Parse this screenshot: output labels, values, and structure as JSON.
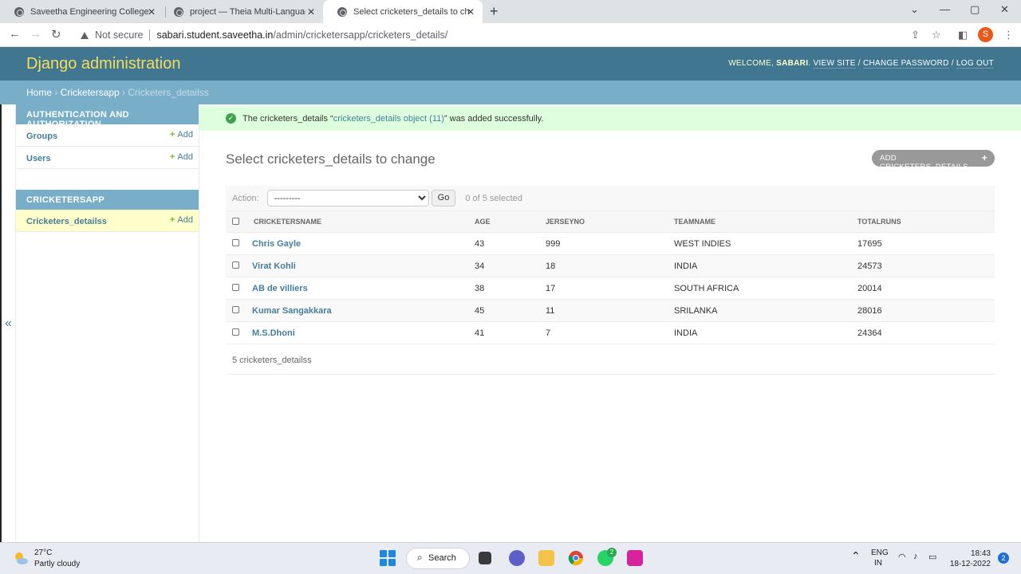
{
  "browser": {
    "tabs": [
      {
        "title": "Saveetha Engineering College"
      },
      {
        "title": "project — Theia Multi-Language"
      },
      {
        "title": "Select cricketers_details to chang"
      }
    ],
    "security_label": "Not secure",
    "url_host": "sabari.student.saveetha.in",
    "url_path": "/admin/cricketersapp/cricketers_details/",
    "profile_initial": "S"
  },
  "header": {
    "branding": "Django administration",
    "welcome": "WELCOME,",
    "username": "SABARI",
    "view_site": "VIEW SITE",
    "change_password": "CHANGE PASSWORD",
    "log_out": "LOG OUT"
  },
  "breadcrumbs": {
    "home": "Home",
    "app": "Cricketersapp",
    "current": "Cricketers_detailss"
  },
  "sidebar": {
    "toggle": "«",
    "modules": [
      {
        "caption": "Authentication and Authorization",
        "models": [
          {
            "name": "Groups",
            "add": "Add"
          },
          {
            "name": "Users",
            "add": "Add"
          }
        ]
      },
      {
        "caption": "Cricketersapp",
        "models": [
          {
            "name": "Cricketers_detailss",
            "add": "Add"
          }
        ]
      }
    ]
  },
  "message": {
    "prefix": "The cricketers_details “",
    "link": "cricketers_details object (11)",
    "suffix": "” was added successfully."
  },
  "content": {
    "title": "Select cricketers_details to change",
    "add_button": "ADD CRICKETERS_DETAILS"
  },
  "actions": {
    "label": "Action:",
    "selected_option": "---------",
    "go": "Go",
    "selection_count": "0 of 5 selected"
  },
  "table": {
    "columns": [
      "CRICKETERSNAME",
      "AGE",
      "JERSEYNO",
      "TEAMNAME",
      "TOTALRUNS"
    ],
    "rows": [
      {
        "name": "Chris Gayle",
        "age": "43",
        "jersey": "999",
        "team": "WEST INDIES",
        "runs": "17695"
      },
      {
        "name": "Virat Kohli",
        "age": "34",
        "jersey": "18",
        "team": "INDIA",
        "runs": "24573"
      },
      {
        "name": "AB de villiers",
        "age": "38",
        "jersey": "17",
        "team": "SOUTH AFRICA",
        "runs": "20014"
      },
      {
        "name": "Kumar Sangakkara",
        "age": "45",
        "jersey": "11",
        "team": "SRILANKA",
        "runs": "28016"
      },
      {
        "name": "M.S.Dhoni",
        "age": "41",
        "jersey": "7",
        "team": "INDIA",
        "runs": "24364"
      }
    ]
  },
  "paginator": "5 cricketers_detailss",
  "taskbar": {
    "temperature": "27°C",
    "weather": "Partly cloudy",
    "search": "Search",
    "whatsapp_badge": "2",
    "language_top": "ENG",
    "language_bottom": "IN",
    "time": "18:43",
    "date": "18-12-2022",
    "notifications": "2"
  }
}
